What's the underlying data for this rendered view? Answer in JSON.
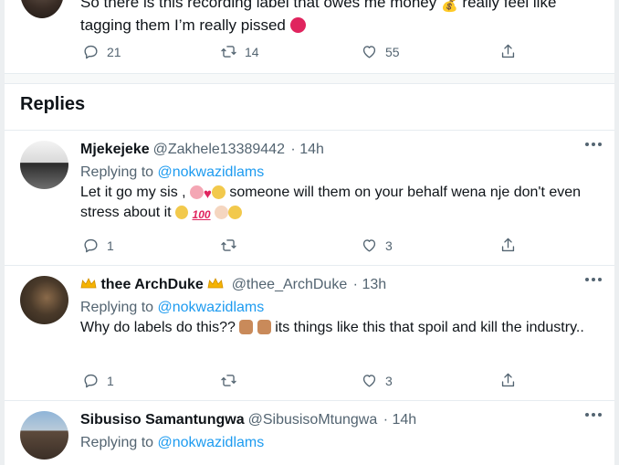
{
  "top_tweet": {
    "text_before": "So there is this recording label that owes me money",
    "text_middle": "really feel like tagging them I’m really pissed",
    "reply_count": "21",
    "retweet_count": "14",
    "like_count": "55"
  },
  "replies_heading": "Replies",
  "replies": [
    {
      "name": "Mjekejeke",
      "handle": "@Zakhele13389442",
      "time": "· 14h",
      "replying_prefix": "Replying to",
      "replying_to": "@nokwazidlams",
      "text_a": "Let it go my sis ,",
      "text_b": "someone will them on your behalf wena nje don't even stress about it",
      "reply_count": "1",
      "retweet_count": "",
      "like_count": "3"
    },
    {
      "name": "thee ArchDuke",
      "handle": "@thee_ArchDuke",
      "time": "· 13h",
      "replying_prefix": "Replying to",
      "replying_to": "@nokwazidlams",
      "text_a": "Why do labels do this??",
      "text_b": "its things like this that spoil and kill the industry..",
      "reply_count": "1",
      "retweet_count": "",
      "like_count": "3"
    },
    {
      "name": "Sibusiso Samantungwa",
      "handle": "@SibusisoMtungwa",
      "time": "· 14h",
      "replying_prefix": "Replying to",
      "replying_to": "@nokwazidlams"
    }
  ],
  "colors": {
    "link": "#1d9bf0",
    "secondary_text": "#536471",
    "divider": "#e6ecf0"
  },
  "icons": [
    "reply-icon",
    "retweet-icon",
    "like-icon",
    "share-icon",
    "more-icon"
  ]
}
